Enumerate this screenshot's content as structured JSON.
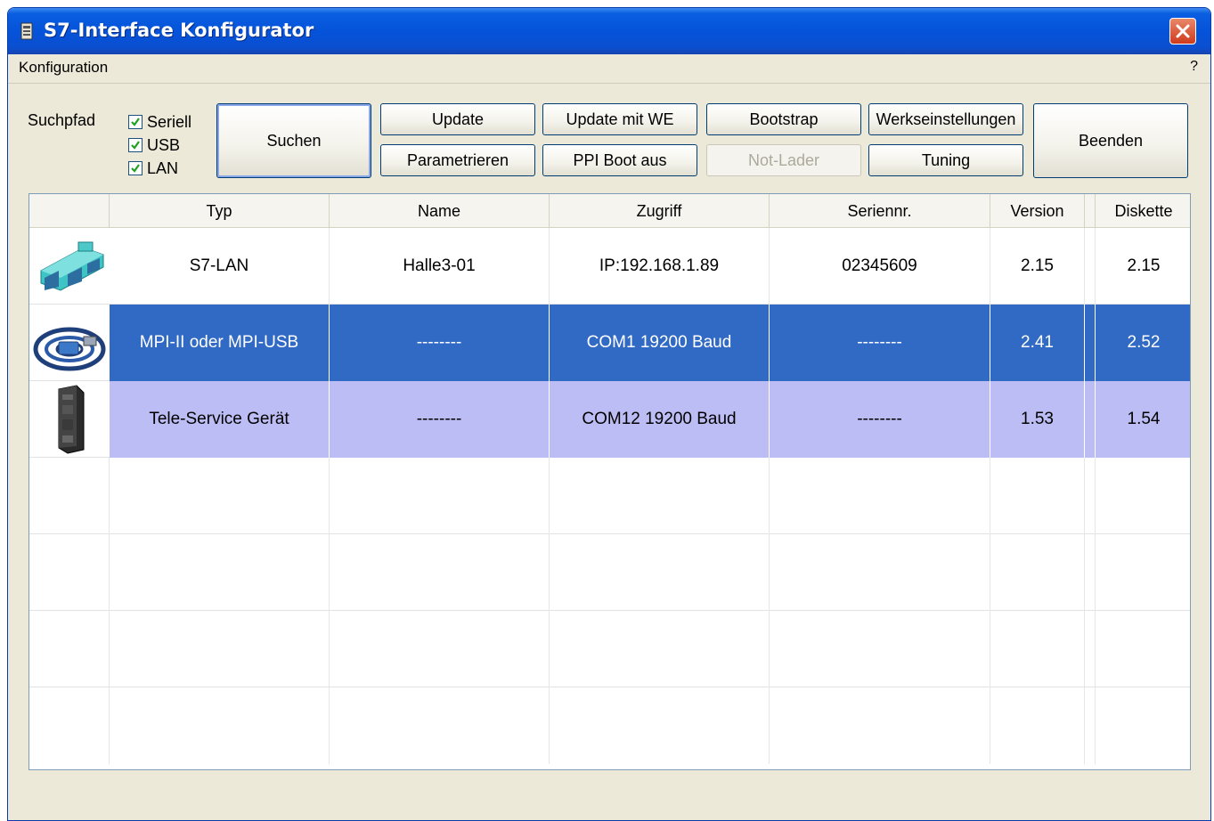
{
  "window": {
    "title": "S7-Interface Konfigurator"
  },
  "menu": {
    "konfiguration": "Konfiguration",
    "help": "?"
  },
  "search": {
    "label": "Suchpfad",
    "options": [
      {
        "label": "Seriell",
        "checked": true
      },
      {
        "label": "USB",
        "checked": true
      },
      {
        "label": "LAN",
        "checked": true
      }
    ]
  },
  "buttons": {
    "suchen": "Suchen",
    "update": "Update",
    "update_mit_we": "Update mit WE",
    "bootstrap": "Bootstrap",
    "werkseinstellungen": "Werkseinstellungen",
    "beenden": "Beenden",
    "parametrieren": "Parametrieren",
    "ppi_boot_aus": "PPI Boot aus",
    "not_lader": "Not-Lader",
    "tuning": "Tuning"
  },
  "table": {
    "columns": [
      "",
      "Typ",
      "Name",
      "Zugriff",
      "Seriennr.",
      "Version",
      "Diskette"
    ],
    "rows": [
      {
        "device_icon": "s7-lan-adapter-icon",
        "typ": "S7-LAN",
        "name": "Halle3-01",
        "zugriff": "IP:192.168.1.89",
        "seriennr": "02345609",
        "version": "2.15",
        "diskette": "2.15",
        "state": "normal"
      },
      {
        "device_icon": "mpi-usb-cable-icon",
        "typ": "MPI-II oder MPI-USB",
        "name": "--------",
        "zugriff": "COM1 19200 Baud",
        "seriennr": "--------",
        "version": "2.41",
        "diskette": "2.52",
        "state": "selected"
      },
      {
        "device_icon": "teleservice-device-icon",
        "typ": "Tele-Service Gerät",
        "name": "--------",
        "zugriff": "COM12 19200 Baud",
        "seriennr": "--------",
        "version": "1.53",
        "diskette": "1.54",
        "state": "highlighted"
      }
    ]
  },
  "colors": {
    "title_bar": "#0553da",
    "selection": "#316ac5",
    "highlight": "#bdbdf5",
    "window_bg": "#ece9d8"
  }
}
